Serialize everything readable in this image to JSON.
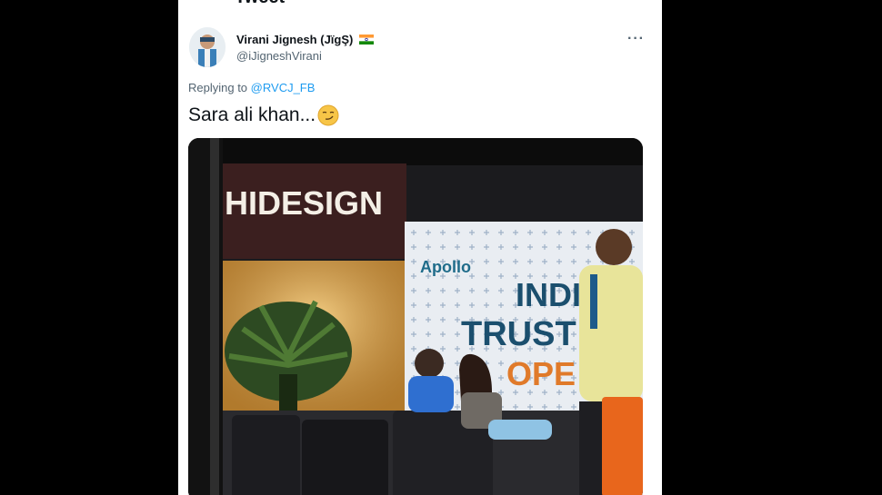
{
  "header": {
    "title": "Tweet",
    "back_icon": "arrow-left-icon"
  },
  "tweet": {
    "author_name": "Virani Jignesh (JïgŞ)",
    "author_flag": "india-flag-icon",
    "author_handle": "@iJigneshVirani",
    "replying_prefix": "Replying to",
    "replying_to": "@RVCJ_FB",
    "text": "Sara ali khan...",
    "emoji": "smirking-face-emoji",
    "more_icon": "more-options-icon"
  },
  "media": {
    "store_sign": "HIDESIGN",
    "banner_brand": "Apollo",
    "banner_lines": [
      "INDI",
      "TRUST",
      "OPE"
    ]
  },
  "colors": {
    "link": "#1d9bf0",
    "secondary_text": "#536471",
    "primary_text": "#0f1419"
  }
}
